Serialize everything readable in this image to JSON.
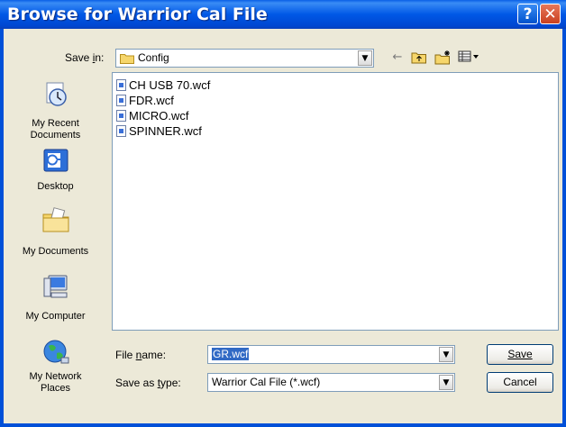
{
  "window": {
    "title": "Browse for Warrior Cal File",
    "help_glyph": "?",
    "close_glyph": "✕"
  },
  "toolbar": {
    "save_in_label": "Save in:",
    "save_in_value": "Config",
    "back_icon": "←",
    "up_icon": "⬑",
    "new_folder_icon": "✱",
    "views_icon": "▦▾"
  },
  "places": [
    {
      "label": "My Recent\nDocuments",
      "icon": "recent-documents-icon"
    },
    {
      "label": "Desktop",
      "icon": "desktop-icon"
    },
    {
      "label": "My Documents",
      "icon": "my-documents-icon"
    },
    {
      "label": "My Computer",
      "icon": "my-computer-icon"
    },
    {
      "label": "My Network\nPlaces",
      "icon": "network-places-icon"
    }
  ],
  "files": [
    "CH USB 70.wcf",
    "FDR.wcf",
    "MICRO.wcf",
    "SPINNER.wcf"
  ],
  "form": {
    "file_name_label": "File name:",
    "file_name_value": "GR.wcf",
    "save_type_label": "Save as type:",
    "save_type_value": "Warrior Cal File (*.wcf)"
  },
  "buttons": {
    "save": "Save",
    "cancel": "Cancel"
  }
}
